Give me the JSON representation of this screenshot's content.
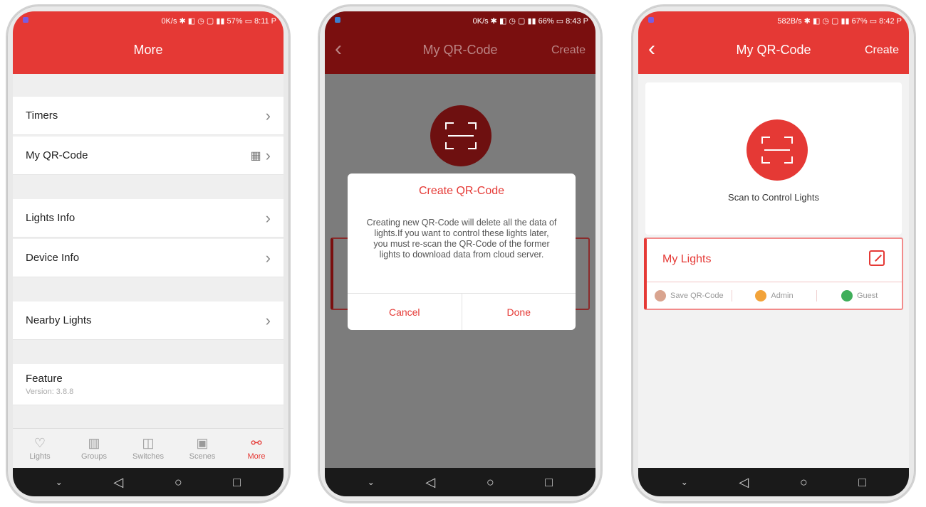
{
  "screen1": {
    "status_text": "0K/s ✱ ◧ ◷ ▢ ▮▮ 57% ▭ 8:11 P",
    "title": "More",
    "rows": [
      {
        "label": "Timers"
      },
      {
        "label": "My QR-Code"
      },
      {
        "label": "Lights Info"
      },
      {
        "label": "Device Info"
      },
      {
        "label": "Nearby Lights"
      }
    ],
    "feature_label": "Feature",
    "version_text": "Version: 3.8.8",
    "tabs": [
      {
        "label": "Lights",
        "icon": "lightbulb-icon"
      },
      {
        "label": "Groups",
        "icon": "grid-icon"
      },
      {
        "label": "Switches",
        "icon": "switch-icon"
      },
      {
        "label": "Scenes",
        "icon": "scenes-icon"
      },
      {
        "label": "More",
        "icon": "share-icon"
      }
    ],
    "active_tab": "More"
  },
  "screen2": {
    "status_text": "0K/s ✱ ◧ ◷ ▢ ▮▮ 66% ▭ 8:43 P",
    "title": "My QR-Code",
    "action": "Create",
    "dialog": {
      "title": "Create QR-Code",
      "message": "Creating new QR-Code will delete all the data of lights.If you want to control these lights later, you must re-scan the QR-Code of the former lights to download data from cloud server.",
      "cancel_label": "Cancel",
      "done_label": "Done"
    }
  },
  "screen3": {
    "status_text": "582B/s ✱ ◧ ◷ ▢ ▮▮ 67% ▭ 8:42 P",
    "title": "My QR-Code",
    "action": "Create",
    "scan_caption": "Scan to Control Lights",
    "lights_title": "My Lights",
    "options": [
      {
        "label": "Save QR-Code",
        "color": "#d9a48f"
      },
      {
        "label": "Admin",
        "color": "#f2a33a"
      },
      {
        "label": "Guest",
        "color": "#3fae5a"
      }
    ]
  },
  "colors": {
    "accent": "#e53935",
    "dark_accent": "#7a0f0f",
    "overlay": "#7c7c7c"
  }
}
